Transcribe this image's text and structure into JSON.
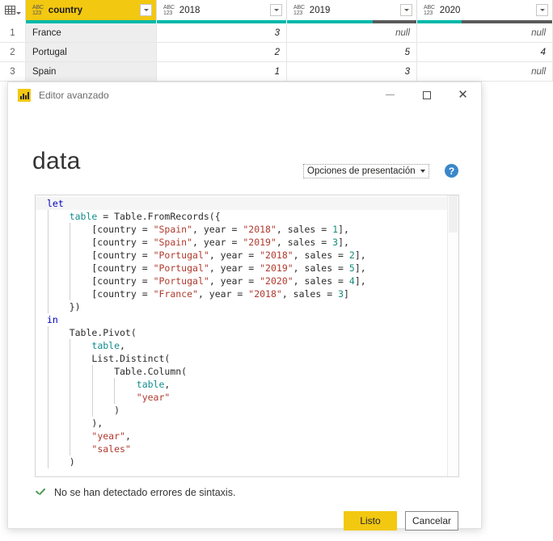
{
  "grid": {
    "row_header_icon": "table-icon",
    "columns": [
      {
        "name": "country",
        "type_label_top": "ABC",
        "type_label_bottom": "123",
        "selected": true,
        "valid_pct": 100,
        "empty_pct": 0
      },
      {
        "name": "2018",
        "type_label_top": "ABC",
        "type_label_bottom": "123",
        "selected": false,
        "valid_pct": 100,
        "empty_pct": 0
      },
      {
        "name": "2019",
        "type_label_top": "ABC",
        "type_label_bottom": "123",
        "selected": false,
        "valid_pct": 66,
        "empty_pct": 34
      },
      {
        "name": "2020",
        "type_label_top": "ABC",
        "type_label_bottom": "123",
        "selected": false,
        "valid_pct": 33,
        "empty_pct": 67
      }
    ],
    "rows": [
      {
        "index": "1",
        "country": "France",
        "y2018": "3",
        "y2019": "null",
        "y2020": "null"
      },
      {
        "index": "2",
        "country": "Portugal",
        "y2018": "2",
        "y2019": "5",
        "y2020": "4"
      },
      {
        "index": "3",
        "country": "Spain",
        "y2018": "1",
        "y2019": "3",
        "y2020": "null"
      }
    ]
  },
  "dialog": {
    "title": "Editor avanzado",
    "app_icon": "power-bi-icon",
    "window_controls": {
      "minimize": "minimize-icon",
      "maximize": "maximize-icon",
      "close": "close-icon"
    },
    "heading": "data",
    "display_options": {
      "label": "Opciones de presentación",
      "caret": "chevron-down-icon"
    },
    "help": {
      "glyph": "?",
      "name": "help-icon",
      "color": "#3b87c9"
    },
    "status": {
      "icon": "checkmark-icon",
      "text": "No se han detectado errores de sintaxis.",
      "color": "#4e9a51"
    },
    "buttons": {
      "ok": "Listo",
      "cancel": "Cancelar",
      "ok_color": "#f2c811"
    },
    "code_lines": [
      [
        {
          "t": "let",
          "c": "kw"
        }
      ],
      [
        {
          "t": "    ",
          "c": ""
        },
        {
          "t": "table",
          "c": "id"
        },
        {
          "t": " = Table.FromRecords({",
          "c": ""
        }
      ],
      [
        {
          "t": "        [country = ",
          "c": ""
        },
        {
          "t": "\"Spain\"",
          "c": "str"
        },
        {
          "t": ", year = ",
          "c": ""
        },
        {
          "t": "\"2018\"",
          "c": "str"
        },
        {
          "t": ", sales = ",
          "c": ""
        },
        {
          "t": "1",
          "c": "num"
        },
        {
          "t": "],",
          "c": ""
        }
      ],
      [
        {
          "t": "        [country = ",
          "c": ""
        },
        {
          "t": "\"Spain\"",
          "c": "str"
        },
        {
          "t": ", year = ",
          "c": ""
        },
        {
          "t": "\"2019\"",
          "c": "str"
        },
        {
          "t": ", sales = ",
          "c": ""
        },
        {
          "t": "3",
          "c": "num"
        },
        {
          "t": "],",
          "c": ""
        }
      ],
      [
        {
          "t": "        [country = ",
          "c": ""
        },
        {
          "t": "\"Portugal\"",
          "c": "str"
        },
        {
          "t": ", year = ",
          "c": ""
        },
        {
          "t": "\"2018\"",
          "c": "str"
        },
        {
          "t": ", sales = ",
          "c": ""
        },
        {
          "t": "2",
          "c": "num"
        },
        {
          "t": "],",
          "c": ""
        }
      ],
      [
        {
          "t": "        [country = ",
          "c": ""
        },
        {
          "t": "\"Portugal\"",
          "c": "str"
        },
        {
          "t": ", year = ",
          "c": ""
        },
        {
          "t": "\"2019\"",
          "c": "str"
        },
        {
          "t": ", sales = ",
          "c": ""
        },
        {
          "t": "5",
          "c": "num"
        },
        {
          "t": "],",
          "c": ""
        }
      ],
      [
        {
          "t": "        [country = ",
          "c": ""
        },
        {
          "t": "\"Portugal\"",
          "c": "str"
        },
        {
          "t": ", year = ",
          "c": ""
        },
        {
          "t": "\"2020\"",
          "c": "str"
        },
        {
          "t": ", sales = ",
          "c": ""
        },
        {
          "t": "4",
          "c": "num"
        },
        {
          "t": "],",
          "c": ""
        }
      ],
      [
        {
          "t": "        [country = ",
          "c": ""
        },
        {
          "t": "\"France\"",
          "c": "str"
        },
        {
          "t": ", year = ",
          "c": ""
        },
        {
          "t": "\"2018\"",
          "c": "str"
        },
        {
          "t": ", sales = ",
          "c": ""
        },
        {
          "t": "3",
          "c": "num"
        },
        {
          "t": "]",
          "c": ""
        }
      ],
      [
        {
          "t": "    })",
          "c": ""
        }
      ],
      [
        {
          "t": "in",
          "c": "kw"
        }
      ],
      [
        {
          "t": "    Table.Pivot(",
          "c": ""
        }
      ],
      [
        {
          "t": "        ",
          "c": ""
        },
        {
          "t": "table",
          "c": "id"
        },
        {
          "t": ",",
          "c": ""
        }
      ],
      [
        {
          "t": "        List.Distinct(",
          "c": ""
        }
      ],
      [
        {
          "t": "            Table.Column(",
          "c": ""
        }
      ],
      [
        {
          "t": "                ",
          "c": ""
        },
        {
          "t": "table",
          "c": "id"
        },
        {
          "t": ",",
          "c": ""
        }
      ],
      [
        {
          "t": "                ",
          "c": ""
        },
        {
          "t": "\"year\"",
          "c": "str"
        }
      ],
      [
        {
          "t": "            )",
          "c": ""
        }
      ],
      [
        {
          "t": "        ),",
          "c": ""
        }
      ],
      [
        {
          "t": "        ",
          "c": ""
        },
        {
          "t": "\"year\"",
          "c": "str"
        },
        {
          "t": ",",
          "c": ""
        }
      ],
      [
        {
          "t": "        ",
          "c": ""
        },
        {
          "t": "\"sales\"",
          "c": "str"
        }
      ],
      [
        {
          "t": "    )",
          "c": ""
        }
      ]
    ]
  }
}
